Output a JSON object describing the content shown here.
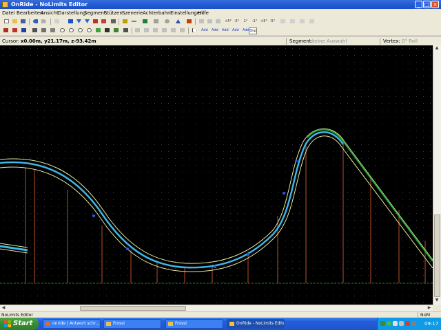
{
  "window": {
    "title": "OnRide - NoLimits Editor",
    "buttons": {
      "minimize": "_",
      "maximize": "□",
      "close": "×"
    }
  },
  "menu": [
    "Datei",
    "Bearbeiten",
    "Ansicht",
    "Darstellung",
    "Segment",
    "Stützen",
    "Szenerie",
    "Achterbahn",
    "Einstellungen",
    "Hilfe"
  ],
  "toolbar2_labels": {
    "add1": "Add",
    "add2": "Add",
    "add3": "Add",
    "add4": "Add",
    "add5": "Add",
    "snp": "Snp"
  },
  "statusline": {
    "cursor_label": "Cursor:",
    "cursor_value": "x0.00m, y21.17m, z-93.42m",
    "segment_label": "Segment:",
    "segment_value": "keine Auswahl",
    "vertex_label": "Vertex:",
    "vertex_value": "0° Roll"
  },
  "app_status": {
    "left": "NoLimits Editor",
    "num": "NUM"
  },
  "taskbar": {
    "start": "Start",
    "tasks": [
      {
        "label": "onride | Antwort schr..."
      },
      {
        "label": "Frossi"
      },
      {
        "label": "Frossi"
      },
      {
        "label": "OnRide - NoLimits Editor"
      }
    ],
    "clock": "09:17"
  },
  "colors": {
    "viewport_bg": "#000000",
    "grid_dot": "#3a3a3a",
    "track_outer": "#e8e6a0",
    "track_inner": "#3fb6e8",
    "track_green": "#26a836",
    "supports": "#b85028",
    "ground_line": "#1c8a1c"
  }
}
